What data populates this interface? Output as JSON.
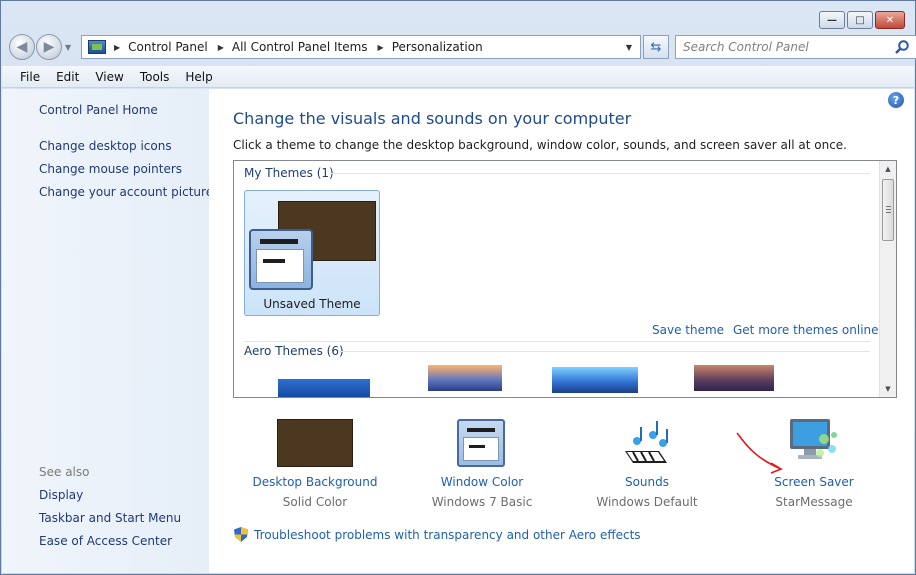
{
  "titlebar": {
    "minimize_glyph": "—",
    "maximize_glyph": "□",
    "close_glyph": "✕"
  },
  "nav": {
    "back_glyph": "◀",
    "forward_glyph": "▶",
    "breadcrumbs": [
      "Control Panel",
      "All Control Panel Items",
      "Personalization"
    ],
    "search_placeholder": "Search Control Panel"
  },
  "menu": [
    "File",
    "Edit",
    "View",
    "Tools",
    "Help"
  ],
  "sidebar": {
    "home": "Control Panel Home",
    "links": [
      "Change desktop icons",
      "Change mouse pointers",
      "Change your account picture"
    ],
    "see_also_heading": "See also",
    "see_also": [
      "Display",
      "Taskbar and Start Menu",
      "Ease of Access Center"
    ]
  },
  "main": {
    "title": "Change the visuals and sounds on your computer",
    "description": "Click a theme to change the desktop background, window color, sounds, and screen saver all at once.",
    "my_themes_heading": "My Themes (1)",
    "current_theme": "Unsaved Theme",
    "save_theme": "Save theme",
    "get_more_themes": "Get more themes online",
    "aero_themes_heading": "Aero Themes (6)",
    "help_glyph": "?"
  },
  "settings": [
    {
      "label": "Desktop Background",
      "value": "Solid Color",
      "icon": "desktop-background-icon"
    },
    {
      "label": "Window Color",
      "value": "Windows 7 Basic",
      "icon": "window-color-icon"
    },
    {
      "label": "Sounds",
      "value": "Windows Default",
      "icon": "sounds-icon"
    },
    {
      "label": "Screen Saver",
      "value": "StarMessage",
      "icon": "screen-saver-icon"
    }
  ],
  "troubleshoot": "Troubleshoot problems with transparency and other Aero effects",
  "colors": {
    "link": "#1f5fb0",
    "heading": "#1e4b8c",
    "annotation_arrow": "#e8141b"
  }
}
